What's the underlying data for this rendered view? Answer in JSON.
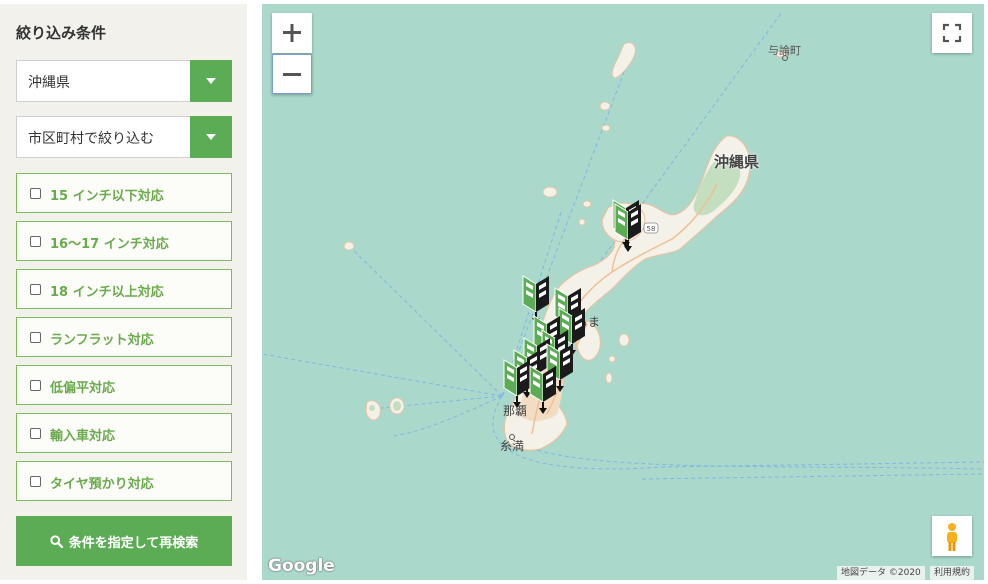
{
  "sidebar": {
    "title": "絞り込み条件",
    "prefecture_select": {
      "value": "沖縄県"
    },
    "city_select": {
      "value": "市区町村で絞り込む"
    },
    "checkboxes": [
      {
        "label": "15 インチ以下対応",
        "checked": false
      },
      {
        "label": "16～17 インチ対応",
        "checked": false
      },
      {
        "label": "18 インチ以上対応",
        "checked": false
      },
      {
        "label": "ランフラット対応",
        "checked": false
      },
      {
        "label": "低偏平対応",
        "checked": false
      },
      {
        "label": "輸入車対応",
        "checked": false
      },
      {
        "label": "タイヤ預かり対応",
        "checked": false
      }
    ],
    "search_button": {
      "label": "条件を指定して再検索",
      "icon": "search-icon"
    }
  },
  "map": {
    "labels": {
      "yoron": "与論町",
      "okinawa_pref": "沖縄県",
      "naha": "那覇",
      "itoman": "糸満",
      "uruma": "るま",
      "route": "58"
    },
    "controls": {
      "zoom_in": "+",
      "zoom_out": "−",
      "fullscreen": "fullscreen-icon",
      "street_view": "pegman-icon"
    },
    "google_logo": "Google",
    "attribution": "地図データ ©2020",
    "terms": "利用規約",
    "marker_icon": "beginner-driver-mark",
    "marker_count": 12,
    "colors": {
      "sea": "#aad9cc",
      "land": "#f4f1e8",
      "forest": "#c3dfc0",
      "road": "#f2bf93",
      "accent": "#5cac55"
    }
  }
}
